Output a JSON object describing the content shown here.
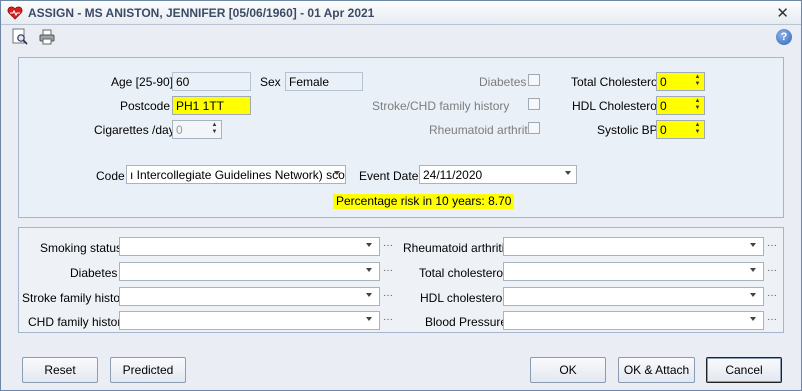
{
  "window": {
    "title": "ASSIGN - MS ANISTON, JENNIFER [05/06/1960] - 01 Apr 2021",
    "close_glyph": "✕"
  },
  "toolbar": {
    "icons": [
      "preview-icon",
      "print-icon"
    ],
    "help_glyph": "?"
  },
  "patient": {
    "age_label": "Age [25-90]",
    "age_value": "60",
    "sex_label": "Sex",
    "sex_value": "Female",
    "postcode_label": "Postcode",
    "postcode_value": "PH1 1TT",
    "cigs_label": "Cigarettes /day",
    "cigs_value": "0"
  },
  "conditions": {
    "diabetes_label": "Diabetes",
    "stroke_chd_label": "Stroke/CHD family history",
    "ra_label": "Rheumatoid arthritis"
  },
  "measures": {
    "total_chol_label": "Total Cholesterol",
    "total_chol_value": "0",
    "hdl_chol_label": "HDL Cholesterol",
    "hdl_chol_value": "0",
    "sbp_label": "Systolic BP",
    "sbp_value": "0"
  },
  "code": {
    "label": "Code",
    "value": "ı Intercollegiate Guidelines Network) score",
    "event_label": "Event Date",
    "event_value": "24/11/2020"
  },
  "risk_text": "Percentage risk in 10 years: 8.70",
  "lower_fields": {
    "smoking": "Smoking status",
    "diabetes": "Diabetes",
    "stroke_family": "Stroke family history",
    "chd_family": "CHD family history",
    "ra": "Rheumatoid arthritis",
    "total_chol": "Total cholesterol",
    "hdl_chol": "HDL cholesterol",
    "bp": "Blood Pressure"
  },
  "ellipsis": "···",
  "buttons": {
    "reset": "Reset",
    "predicted": "Predicted",
    "ok": "OK",
    "ok_attach": "OK & Attach",
    "cancel": "Cancel"
  },
  "colors": {
    "required_field": "#ffff00",
    "title_text": "#3c4b66"
  }
}
